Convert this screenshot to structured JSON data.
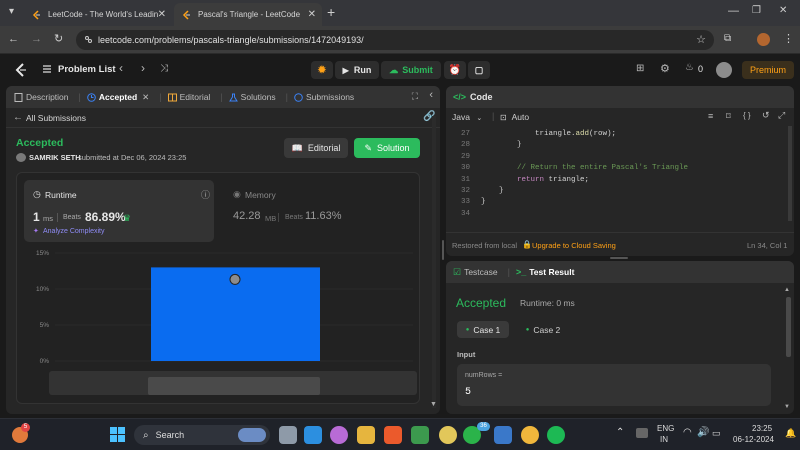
{
  "browser": {
    "tabs": [
      {
        "title": "LeetCode - The World's Leadin",
        "active": false
      },
      {
        "title": "Pascal's Triangle - LeetCode",
        "active": true
      }
    ],
    "url": "leetcode.com/problems/pascals-triangle/submissions/1472049193/"
  },
  "nav": {
    "problem_list": "Problem List",
    "run": "Run",
    "submit": "Submit",
    "streak": "0",
    "premium": "Premium"
  },
  "left_tabs": {
    "description": "Description",
    "accepted": "Accepted",
    "editorial": "Editorial",
    "solutions": "Solutions",
    "submissions": "Submissions"
  },
  "submission": {
    "back": "All Submissions",
    "status": "Accepted",
    "user": "SAMRIK SETH",
    "submitted_text": "submitted at Dec 06, 2024 23:25",
    "editorial_btn": "Editorial",
    "solution_btn": "Solution",
    "runtime_label": "Runtime",
    "runtime_value": "1",
    "runtime_unit": "ms",
    "beats_label": "Beats",
    "runtime_beats": "86.89%",
    "analyze": "Analyze Complexity",
    "memory_label": "Memory",
    "memory_value": "42.28",
    "memory_unit": "MB",
    "memory_beats": "11.63%"
  },
  "chart_data": {
    "type": "bar",
    "yticks": [
      "15%",
      "10%",
      "5%",
      "0%"
    ],
    "ylim": [
      0,
      15
    ],
    "values": [
      13
    ]
  },
  "editor": {
    "panel_title": "Code",
    "language": "Java",
    "mode": "Auto",
    "lines": [
      {
        "n": "27",
        "indent": "            ",
        "parts": [
          [
            "triangle.",
            ""
          ],
          [
            "add",
            "fn"
          ],
          [
            "(row);",
            ""
          ]
        ]
      },
      {
        "n": "28",
        "indent": "        ",
        "parts": [
          [
            "}",
            ""
          ]
        ]
      },
      {
        "n": "29",
        "indent": "",
        "parts": []
      },
      {
        "n": "30",
        "indent": "        ",
        "parts": [
          [
            "// Return the entire Pascal's Triangle",
            "cm"
          ]
        ]
      },
      {
        "n": "31",
        "indent": "        ",
        "parts": [
          [
            "return",
            "kw"
          ],
          [
            " triangle;",
            ""
          ]
        ]
      },
      {
        "n": "32",
        "indent": "    ",
        "parts": [
          [
            "}",
            ""
          ]
        ]
      },
      {
        "n": "33",
        "indent": "",
        "parts": [
          [
            "}",
            ""
          ]
        ]
      },
      {
        "n": "34",
        "indent": "",
        "parts": []
      }
    ],
    "restored": "Restored from local",
    "upgrade": "Upgrade to Cloud Saving",
    "cursor": "Ln 34, Col 1"
  },
  "result": {
    "testcase_tab": "Testcase",
    "result_tab": "Test Result",
    "status": "Accepted",
    "runtime": "Runtime: 0 ms",
    "case1": "Case 1",
    "case2": "Case 2",
    "input_label": "Input",
    "param_name": "numRows =",
    "param_value": "5"
  },
  "taskbar": {
    "search": "Search",
    "lang1": "ENG",
    "lang2": "IN",
    "time": "23:25",
    "date": "06-12-2024",
    "badge": "36",
    "notif": "5"
  }
}
